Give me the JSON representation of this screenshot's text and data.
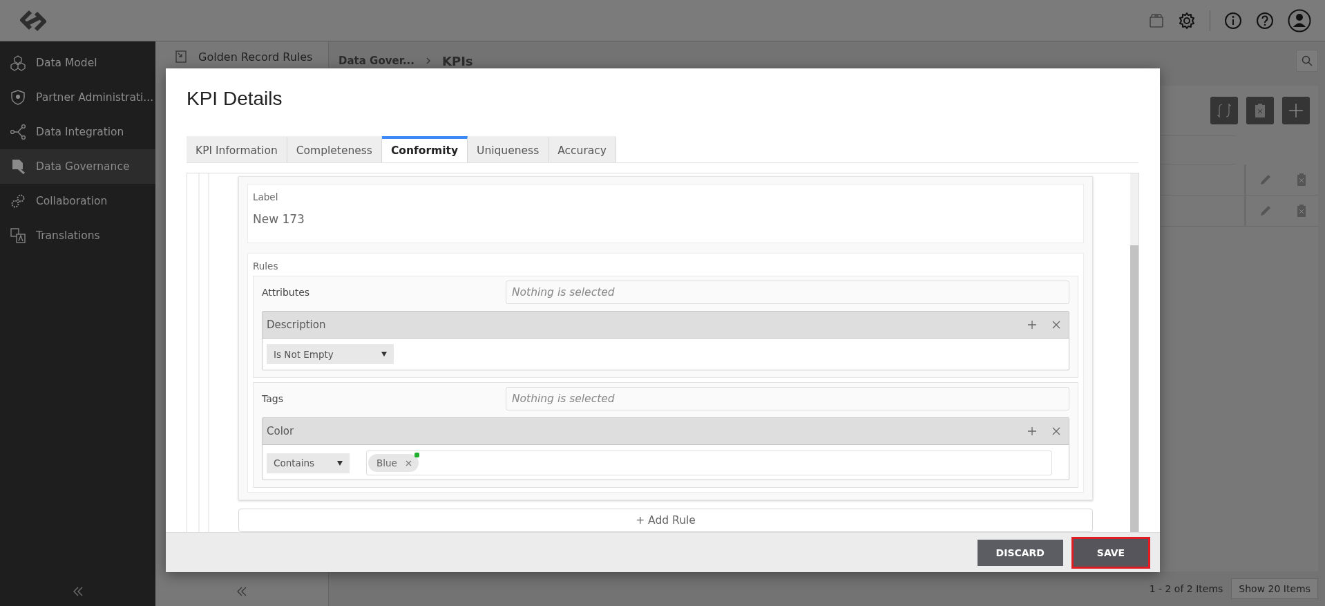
{
  "sidebar": {
    "items": [
      {
        "label": "Data Model",
        "selected": false
      },
      {
        "label": "Partner Administrati...",
        "selected": false
      },
      {
        "label": "Data Integration",
        "selected": false
      },
      {
        "label": "Data Governance",
        "selected": true
      },
      {
        "label": "Collaboration",
        "selected": false
      },
      {
        "label": "Translations",
        "selected": false
      }
    ]
  },
  "subnav": {
    "items": [
      {
        "label": "Golden Record Rules"
      }
    ]
  },
  "breadcrumb": [
    "Data Gover...",
    "KPIs"
  ],
  "pagination": {
    "summary": "1 - 2 of 2 Items",
    "page_size": "Show 20 Items"
  },
  "modal": {
    "title": "KPI Details",
    "tabs": [
      {
        "label": "KPI Information",
        "selected": false
      },
      {
        "label": "Completeness",
        "selected": false
      },
      {
        "label": "Conformity",
        "selected": true
      },
      {
        "label": "Uniqueness",
        "selected": false
      },
      {
        "label": "Accuracy",
        "selected": false
      }
    ],
    "label_field": {
      "label": "Label",
      "value": "New 173"
    },
    "rules": {
      "title": "Rules",
      "groups": [
        {
          "title": "Attributes",
          "placeholder": "Nothing is selected",
          "conditions": [
            {
              "field": "Description",
              "operator": "Is Not Empty"
            }
          ]
        },
        {
          "title": "Tags",
          "placeholder": "Nothing is selected",
          "conditions": [
            {
              "field": "Color",
              "operator": "Contains",
              "values": [
                {
                  "label": "Blue",
                  "color": "#1fae2e"
                }
              ]
            }
          ]
        }
      ]
    },
    "add_rule": "+ Add Rule",
    "buttons": [
      {
        "label": "DISCARD",
        "kind": "secondary",
        "focused": false
      },
      {
        "label": "SAVE",
        "kind": "primary",
        "focused": true
      }
    ]
  }
}
